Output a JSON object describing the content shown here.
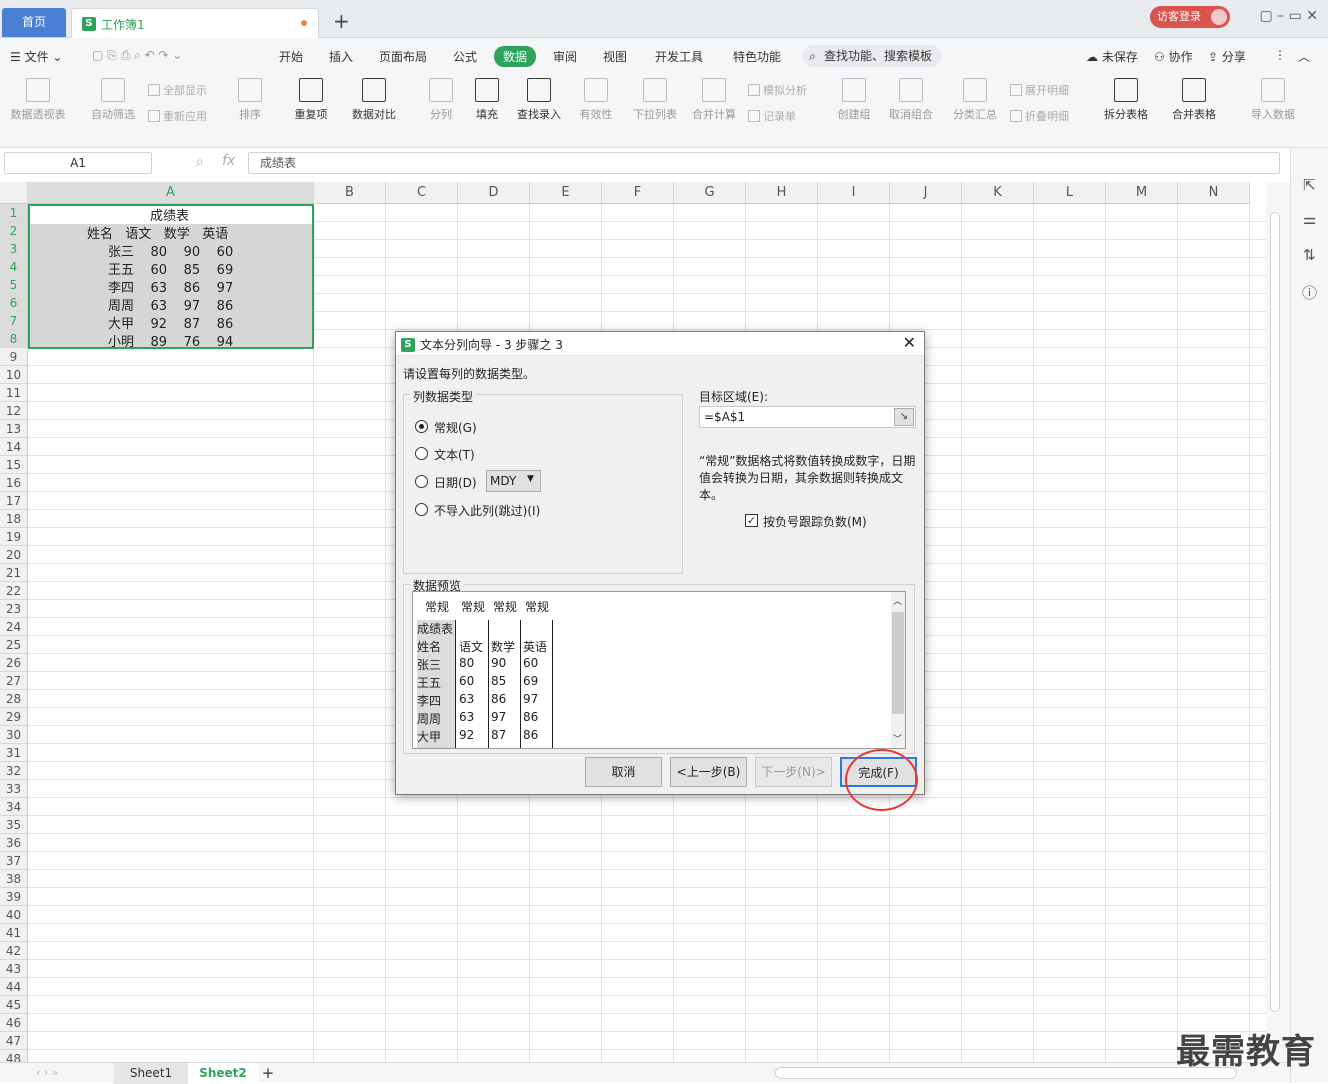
{
  "titlebar": {
    "home_tab": "首页",
    "workbook_tab": "工作簿1",
    "s_logo": "S",
    "win_controls": "▢  –  ▭  ✕",
    "visitor_login": "访客登录"
  },
  "menu": {
    "file": "文件",
    "items": [
      "开始",
      "插入",
      "页面布局",
      "公式",
      "数据",
      "审阅",
      "视图",
      "开发工具",
      "特色功能"
    ],
    "search": "查找功能、搜索模板",
    "unsaved": "未保存",
    "collab": "协作",
    "share": "分享"
  },
  "ribbon": {
    "pivot": "数据透视表",
    "autofilter": "自动筛选",
    "show_all": "全部显示",
    "reapply": "重新应用",
    "sort": "排序",
    "dup": "重复项",
    "compare": "数据对比",
    "split": "分列",
    "fill": "填充",
    "lookup": "查找录入",
    "valid": "有效性",
    "dropdown": "下拉列表",
    "merge_calc": "合并计算",
    "simulate": "模拟分析",
    "record": "记录单",
    "group": "创建组",
    "ungroup": "取消组合",
    "subtotal": "分类汇总",
    "expand": "展开明细",
    "collapse": "折叠明细",
    "split_table": "拆分表格",
    "merge_table": "合并表格",
    "import": "导入数据"
  },
  "formula": {
    "name_box": "A1",
    "fx": "fx",
    "value": "成绩表"
  },
  "columns": [
    "A",
    "B",
    "C",
    "D",
    "E",
    "F",
    "G",
    "H",
    "I",
    "J",
    "K",
    "L",
    "M",
    "N"
  ],
  "rows": [
    "1",
    "2",
    "3",
    "4",
    "5",
    "6",
    "7",
    "8",
    "9",
    "10",
    "11",
    "12",
    "13",
    "14",
    "15",
    "16",
    "17",
    "18",
    "19",
    "20",
    "21",
    "22",
    "23",
    "24",
    "25",
    "26",
    "27",
    "28",
    "29",
    "30",
    "31",
    "32",
    "33",
    "34",
    "35",
    "36",
    "37",
    "38",
    "39",
    "40",
    "41",
    "42",
    "43",
    "44",
    "45",
    "46",
    "47",
    "48"
  ],
  "cells": {
    "r1": "成绩表",
    "r2": "姓名   语文   数学   英语",
    "r3": "张三    80    90    60",
    "r4": "王五    60    85    69",
    "r5": "李四    63    86    97",
    "r6": "周周    63    97    86",
    "r7": "大甲    92    87    86",
    "r8": "小明    89    76    94"
  },
  "sheets": {
    "s1": "Sheet1",
    "s2": "Sheet2",
    "add": "+"
  },
  "dialog": {
    "title": "文本分列向导 - 3 步骤之 3",
    "instruction": "请设置每列的数据类型。",
    "group_label": "列数据类型",
    "opt_general": "常规(G)",
    "opt_text": "文本(T)",
    "opt_date": "日期(D)",
    "date_format": "MDY",
    "opt_skip": "不导入此列(跳过)(I)",
    "dest_label": "目标区域(E):",
    "dest_value": "=$A$1",
    "note": "“常规”数据格式将数值转换成数字，日期值会转换为日期，其余数据则转换成文本。",
    "negative": "按负号跟踪负数(M)",
    "preview_label": "数据预览",
    "preview_headers": [
      "常规",
      "常规",
      "常规",
      "常规"
    ],
    "preview_rows": [
      [
        "成绩表",
        "",
        "",
        ""
      ],
      [
        "姓名",
        "语文",
        "数学",
        "英语"
      ],
      [
        "张三",
        "80",
        "90",
        "60"
      ],
      [
        "王五",
        "60",
        "85",
        "69"
      ],
      [
        "李四",
        "63",
        "86",
        "97"
      ],
      [
        "周周",
        "63",
        "97",
        "86"
      ],
      [
        "大甲",
        "92",
        "87",
        "86"
      ]
    ],
    "cancel": "取消",
    "back": "<上一步(B)",
    "next": "下一步(N)>",
    "finish": "完成(F)"
  },
  "watermark": "最需教育"
}
